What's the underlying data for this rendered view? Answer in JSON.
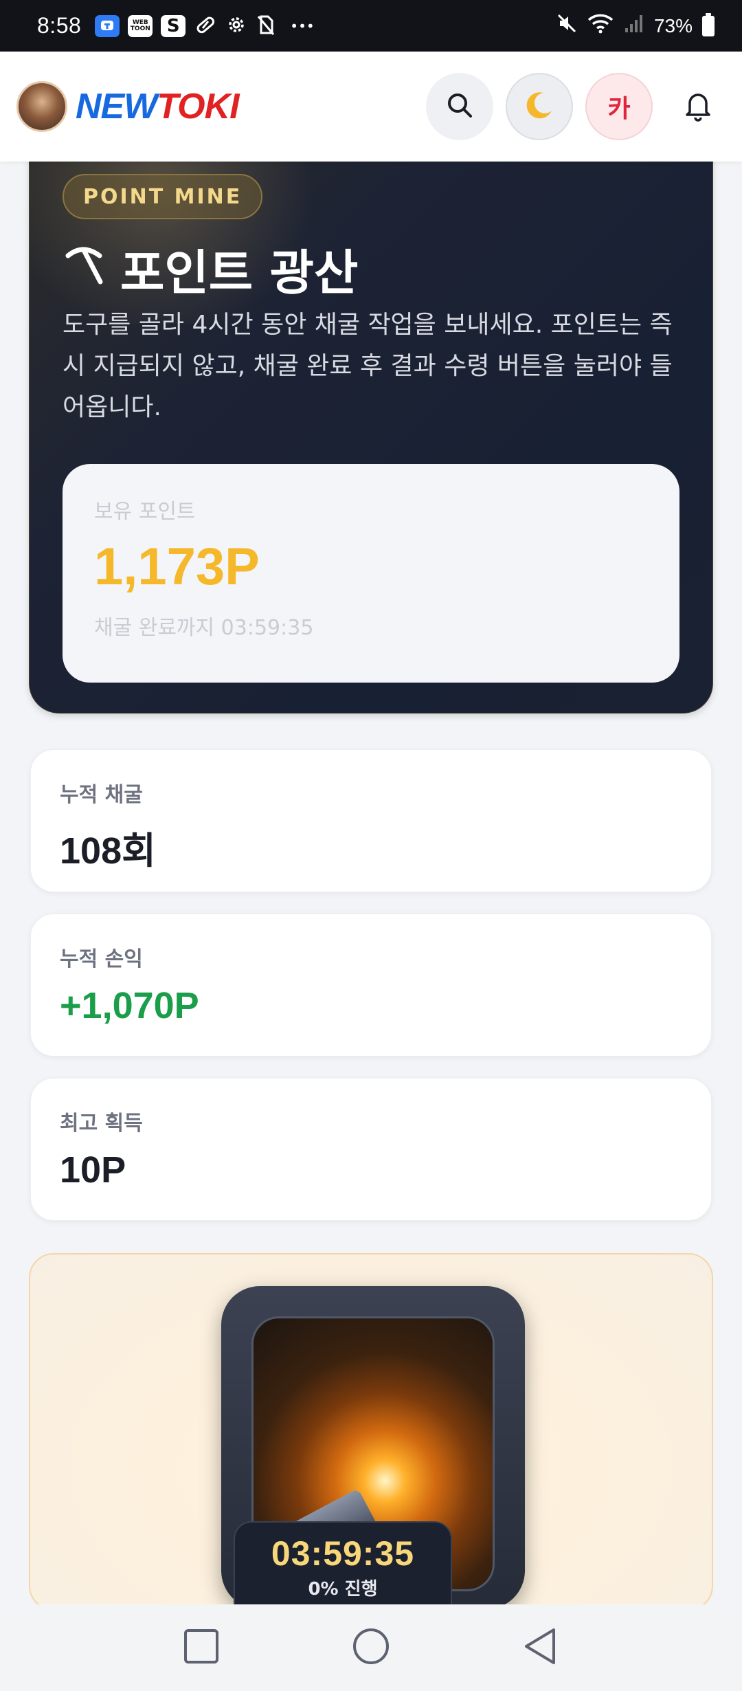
{
  "status_bar": {
    "time": "8:58",
    "battery": "73%",
    "notification_icons": [
      "talk-app-icon",
      "webtoon-app-icon",
      "s-app-icon",
      "pill-icon",
      "gear-icon",
      "no-sim-icon",
      "more-icon"
    ],
    "webtoon_icon_text": "WEB TOON"
  },
  "header": {
    "brand_part1": "NEW",
    "brand_part2": "TOKI",
    "kakao_label": "카"
  },
  "hero": {
    "badge": "POINT MINE",
    "title": "포인트 광산",
    "description": "도구를 골라 4시간 동안 채굴 작업을 보내세요. 포인트는 즉시 지급되지 않고, 채굴 완료 후 결과 수령 버튼을 눌러야 들어옵니다.",
    "points_label": "보유 포인트",
    "points_value": "1,173P",
    "timer_text": "채굴 완료까지 03:59:35"
  },
  "stats": [
    {
      "label": "누적 채굴",
      "value": "108회"
    },
    {
      "label": "누적 손익",
      "value": "+1,070P"
    },
    {
      "label": "최고 획득",
      "value": "10P"
    }
  ],
  "mine": {
    "timer": "03:59:35",
    "progress_text": "0% 진행",
    "progress_fraction": 0
  },
  "colors": {
    "accent_gold": "#f5b82a",
    "profit_green": "#1a9e4a",
    "brand_blue": "#1769e0",
    "brand_red": "#e02222"
  }
}
